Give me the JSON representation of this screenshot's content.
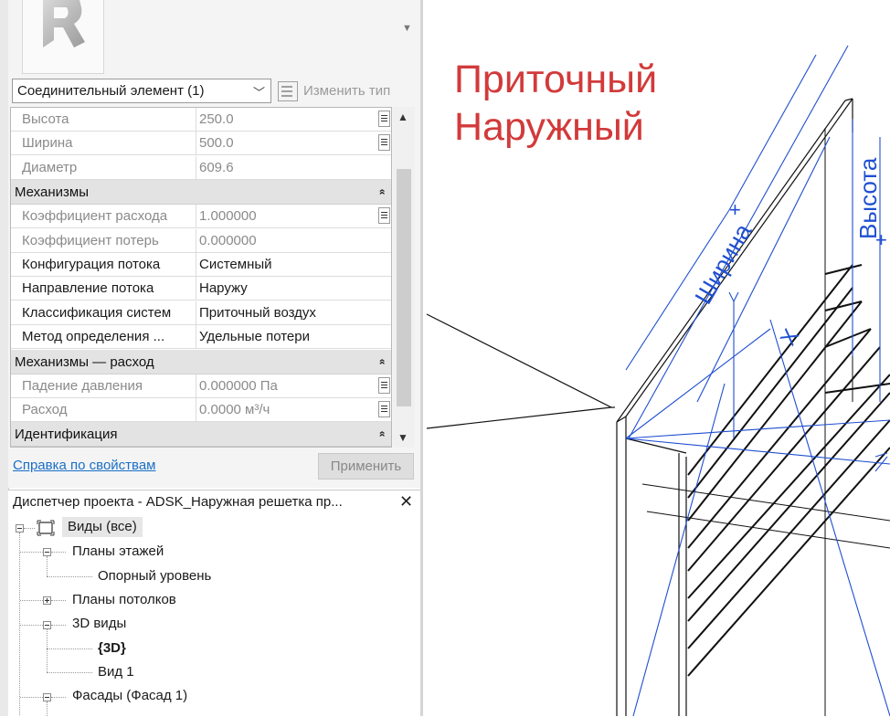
{
  "properties": {
    "type_selector": "Соединительный элемент (1)",
    "edit_type_label": "Изменить тип",
    "rows_top": [
      {
        "name": "Высота",
        "value": "250.0",
        "readonly": true,
        "button": true
      },
      {
        "name": "Ширина",
        "value": "500.0",
        "readonly": true,
        "button": true
      },
      {
        "name": "Диаметр",
        "value": "609.6",
        "readonly": true,
        "button": false
      }
    ],
    "group_mechanisms": "Механизмы",
    "rows_mechanisms": [
      {
        "name": "Коэффициент расхода",
        "value": "1.000000",
        "readonly": true,
        "button": true
      },
      {
        "name": "Коэффициент потерь",
        "value": "0.000000",
        "readonly": true,
        "button": false
      },
      {
        "name": "Конфигурация потока",
        "value": "Системный",
        "readonly": false,
        "button": false
      },
      {
        "name": "Направление потока",
        "value": "Наружу",
        "readonly": false,
        "button": false
      },
      {
        "name": "Классификация систем",
        "value": "Приточный воздух",
        "readonly": false,
        "button": false
      },
      {
        "name": "Метод определения ...",
        "value": "Удельные потери",
        "readonly": false,
        "button": false
      }
    ],
    "group_flow": "Механизмы — расход",
    "rows_flow": [
      {
        "name": "Падение давления",
        "value": "0.000000 Па",
        "readonly": true,
        "button": true
      },
      {
        "name": "Расход",
        "value": "0.0000 м³/ч",
        "readonly": true,
        "button": true
      }
    ],
    "group_ident": "Идентификация",
    "collapse_glyph": "»",
    "help_link": "Справка по свойствам",
    "apply_button": "Применить"
  },
  "project_browser": {
    "title": "Диспетчер проекта - ADSK_Наружная решетка пр...",
    "close_glyph": "✕",
    "nodes": {
      "views_all": "Виды (все)",
      "floor_plans": "Планы этажей",
      "ref_level": "Опорный уровень",
      "ceiling_plans": "Планы потолков",
      "views_3d": "3D виды",
      "view_3d_default": "{3D}",
      "view_1": "Вид 1",
      "elevations": "Фасады (Фасад 1)"
    }
  },
  "view": {
    "label_line1": "Приточный",
    "label_line2": "Наружный",
    "dim_width": "Ширина",
    "dim_height": "Высота",
    "axis_x": "X"
  },
  "colors": {
    "accent_red": "#d23a3a",
    "dimension_blue": "#1f4fd1",
    "link_blue": "#1a6fc7"
  }
}
